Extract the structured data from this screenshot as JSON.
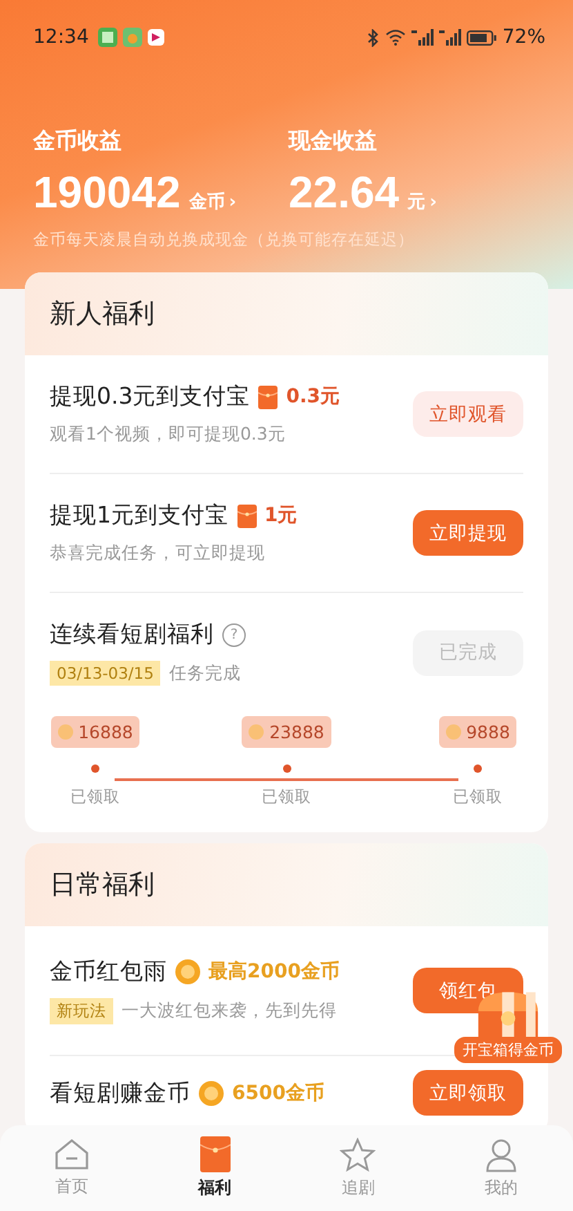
{
  "status_bar": {
    "time": "12:34",
    "battery": "72%"
  },
  "earnings": [
    {
      "label": "金币收益",
      "value": "190042",
      "unit": "金币",
      "arrow": "›"
    },
    {
      "label": "现金收益",
      "value": "22.64",
      "unit": "元",
      "arrow": "›"
    }
  ],
  "earnings_note": "金币每天凌晨自动兑换成现金（兑换可能存在延迟）",
  "newbie": {
    "title": "新人福利",
    "tasks": [
      {
        "title": "提现0.3元到支付宝",
        "reward": "0.3元",
        "desc": "观看1个视频，即可提现0.3元",
        "button": "立即观看",
        "kind": "light"
      },
      {
        "title": "提现1元到支付宝",
        "reward": "1元",
        "desc": "恭喜完成任务，可立即提现",
        "button": "立即提现",
        "kind": "solid"
      }
    ],
    "streak": {
      "title": "连续看短剧福利",
      "help": "?",
      "date_tag": "03/13-03/15",
      "status": "任务完成",
      "button": "已完成",
      "completed": true,
      "milestones": [
        {
          "amount": "16888",
          "label": "已领取"
        },
        {
          "amount": "23888",
          "label": "已领取"
        },
        {
          "amount": "9888",
          "label": "已领取"
        }
      ]
    }
  },
  "daily": {
    "title": "日常福利",
    "tasks": [
      {
        "title": "金币红包雨",
        "reward": "最高2000金币",
        "tag": "新玩法",
        "desc": "一大波红包来袭，先到先得",
        "button": "领红包",
        "kind": "solid"
      },
      {
        "title": "看短剧赚金币",
        "reward": "6500金币",
        "button": "立即领取",
        "kind": "solid"
      }
    ]
  },
  "chest": {
    "label": "开宝箱得金币"
  },
  "nav": [
    {
      "label": "首页",
      "selected": false
    },
    {
      "label": "福利",
      "selected": true
    },
    {
      "label": "追剧",
      "selected": false
    },
    {
      "label": "我的",
      "selected": false
    }
  ]
}
